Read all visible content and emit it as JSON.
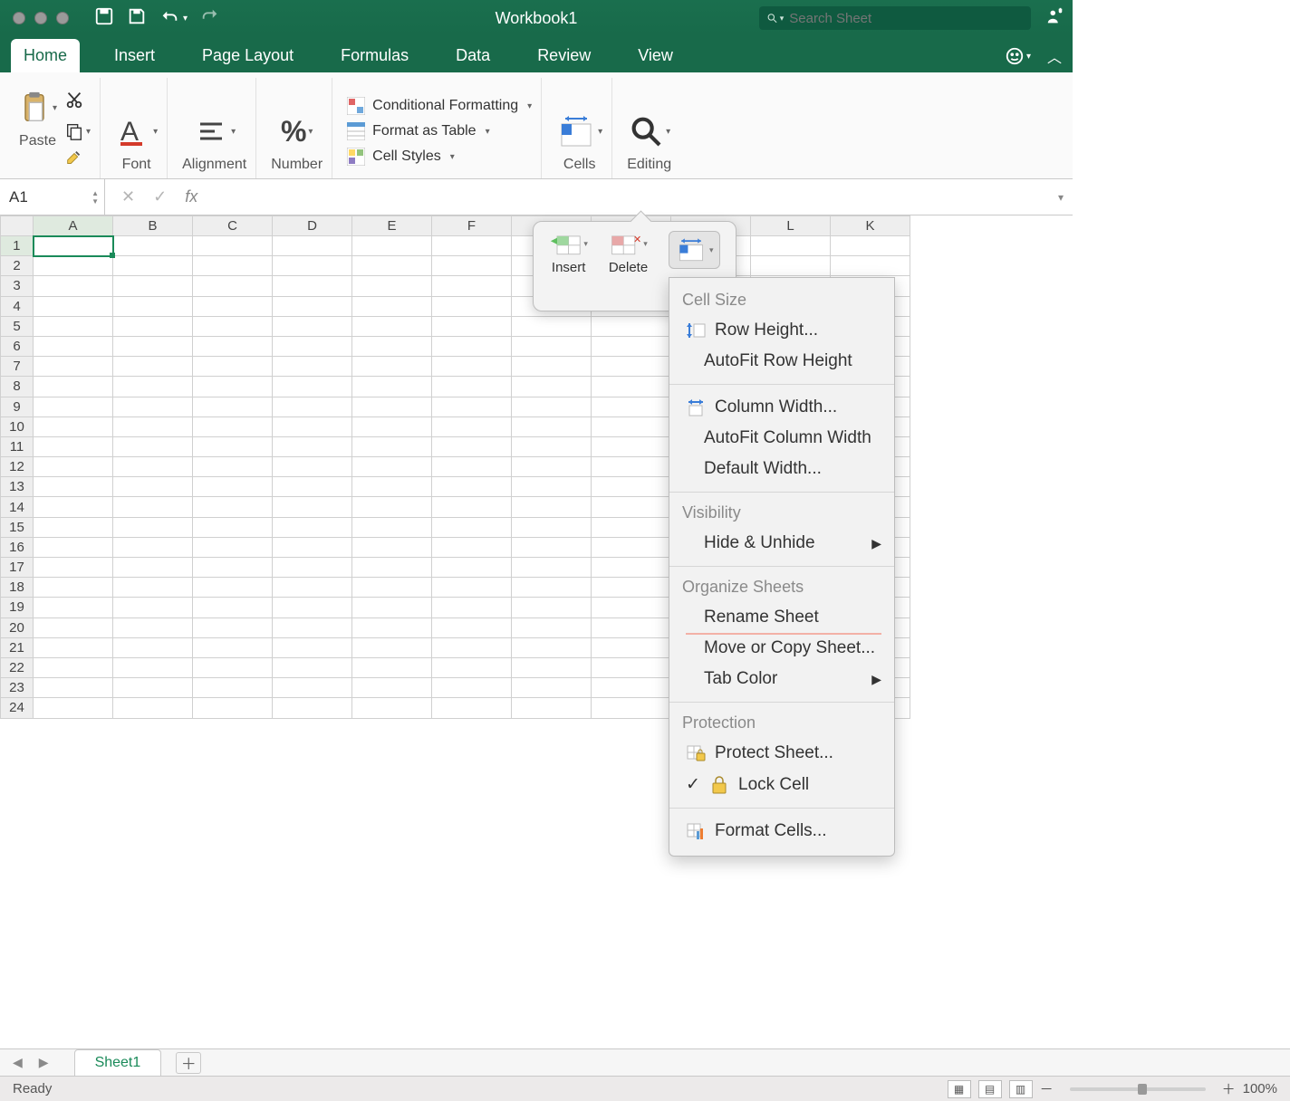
{
  "title": "Workbook1",
  "search_placeholder": "Search Sheet",
  "tabs": [
    "Home",
    "Insert",
    "Page Layout",
    "Formulas",
    "Data",
    "Review",
    "View"
  ],
  "active_tab": "Home",
  "ribbon": {
    "paste": "Paste",
    "font": "Font",
    "alignment": "Alignment",
    "number": "Number",
    "cond_fmt": "Conditional Formatting",
    "fmt_table": "Format as Table",
    "cell_styles": "Cell Styles",
    "cells": "Cells",
    "editing": "Editing"
  },
  "namebox": "A1",
  "columns": [
    "A",
    "B",
    "C",
    "D",
    "E",
    "F",
    "",
    "",
    "",
    "L",
    "K"
  ],
  "rows_count": 24,
  "cells_pop": {
    "insert": "Insert",
    "delete": "Delete"
  },
  "fmt_menu": {
    "sec_cell_size": "Cell Size",
    "row_height": "Row Height...",
    "autofit_row": "AutoFit Row Height",
    "col_width": "Column Width...",
    "autofit_col": "AutoFit Column Width",
    "default_width": "Default Width...",
    "sec_visibility": "Visibility",
    "hide_unhide": "Hide & Unhide",
    "sec_organize": "Organize Sheets",
    "rename": "Rename Sheet",
    "move_copy": "Move or Copy Sheet...",
    "tab_color": "Tab Color",
    "sec_protection": "Protection",
    "protect_sheet": "Protect Sheet...",
    "lock_cell": "Lock Cell",
    "format_cells": "Format Cells..."
  },
  "sheet_tab": "Sheet1",
  "status": "Ready",
  "zoom": "100%"
}
